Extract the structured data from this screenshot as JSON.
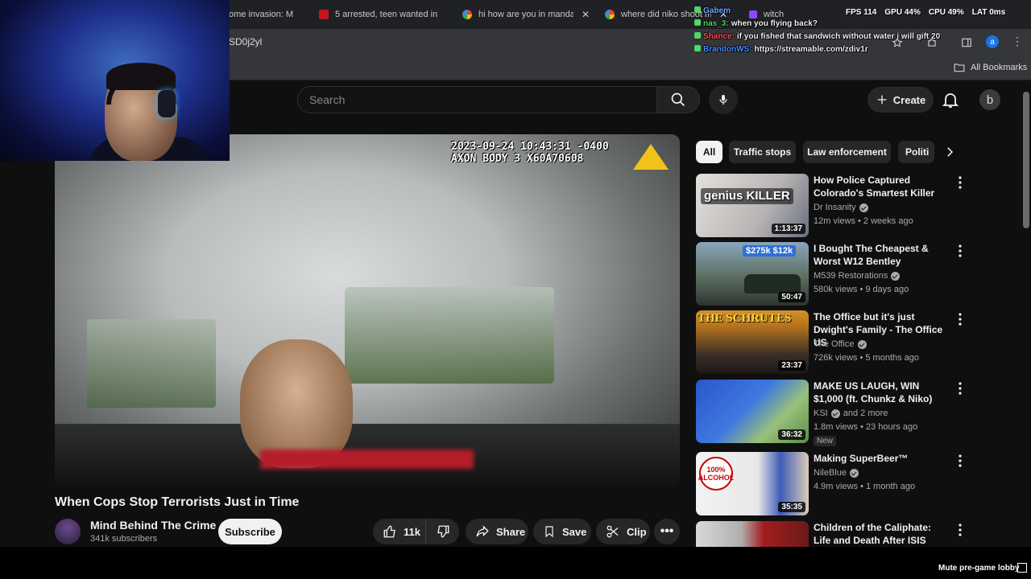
{
  "browser": {
    "tabs": [
      {
        "label": "ome invasion: M",
        "favicon_color": "#202124"
      },
      {
        "label": "5 arrested, teen wanted in",
        "favicon_color": "#c4161c"
      },
      {
        "label": "hi how are you in mandarin",
        "favicon_color": "#4285f4"
      },
      {
        "label": "where did niko shoot mo",
        "favicon_color": "#4285f4"
      },
      {
        "label": "witch",
        "favicon_color": "#9146ff"
      }
    ],
    "url_fragment": "SD0j2yl",
    "bookmarks_label": "All Bookmarks",
    "profile_initial": "a"
  },
  "stream_overlay": {
    "chat": [
      {
        "user": "Gabem",
        "text": "",
        "color": "#6fa8ff"
      },
      {
        "user": "nas_3:",
        "text": "when you flying back?",
        "color": "#4cd964"
      },
      {
        "user": "Shance:",
        "text": "if you fished that sandwich without water i will gift 20",
        "color": "#ff5050"
      },
      {
        "user": "BrandonWS:",
        "text": "https://streamable.com/zdiv1r",
        "color": "#4b8cff"
      }
    ],
    "perf": {
      "fps_label": "FPS",
      "fps_value": "114",
      "gpu_label": "GPU",
      "gpu_value": "44%",
      "cpu_label": "CPU",
      "cpu_value": "49%",
      "lat_label": "LAT",
      "lat_value": "0ms"
    },
    "mute_label": "Mute pre-game lobby"
  },
  "youtube": {
    "search_placeholder": "Search",
    "create_label": "Create",
    "avatar_initial": "b",
    "player": {
      "timestamp_line1": "2023-09-24 10:43:31 -0400",
      "timestamp_line2": "AXON BODY 3 X60A70608"
    },
    "video_title": "When Cops Stop Terrorists Just in Time",
    "channel": {
      "name": "Mind Behind The Crime",
      "subs": "341k subscribers"
    },
    "subscribe_label": "Subscribe",
    "actions": {
      "likes": "11k",
      "share": "Share",
      "save": "Save",
      "clip": "Clip"
    },
    "chips": [
      "All",
      "Traffic stops",
      "Law enforcement",
      "Politi"
    ],
    "recommendations": [
      {
        "title": "How Police Captured Colorado's Smartest Killer",
        "channel": "Dr Insanity",
        "verified": true,
        "meta": "12m views • 2 weeks ago",
        "duration": "1:13:37",
        "thumb_text": "genius KILLER",
        "colors": [
          "#d8d4d0",
          "#8a8a90"
        ]
      },
      {
        "title": "I Bought The Cheapest & Worst W12 Bentley",
        "channel": "M539 Restorations",
        "verified": true,
        "meta": "580k views • 9 days ago",
        "duration": "50:47",
        "thumb_text": "$275k $12k",
        "colors": [
          "#7c9ab0",
          "#3a4a3a"
        ]
      },
      {
        "title": "The Office but it's just Dwight's Family  - The Office US",
        "channel": "The Office",
        "verified": true,
        "meta": "726k views • 5 months ago",
        "duration": "23:37",
        "thumb_text": "THE SCHRUTES",
        "colors": [
          "#c78a2a",
          "#2a2420"
        ]
      },
      {
        "title": "MAKE US LAUGH, WIN $1,000 (ft. Chunkz & Niko)",
        "channel": "KSI",
        "verified": true,
        "channel_extra": "and 2 more",
        "meta": "1.8m views • 23 hours ago",
        "duration": "36:32",
        "badge": "New",
        "thumb_text": "",
        "colors": [
          "#3a6cd4",
          "#8fb37a"
        ]
      },
      {
        "title": "Making SuperBeer™",
        "channel": "NileBlue",
        "verified": true,
        "meta": "4.9m views • 1 month ago",
        "duration": "35:35",
        "thumb_text": "100% ALCOHOL",
        "colors": [
          "#e8e8e8",
          "#3a5ab0"
        ]
      },
      {
        "title": "Children of the Caliphate: Life and Death After ISIS",
        "channel": "",
        "verified": false,
        "meta": "",
        "duration": "",
        "thumb_text": "",
        "colors": [
          "#c4c4c4",
          "#b02020"
        ]
      }
    ]
  }
}
